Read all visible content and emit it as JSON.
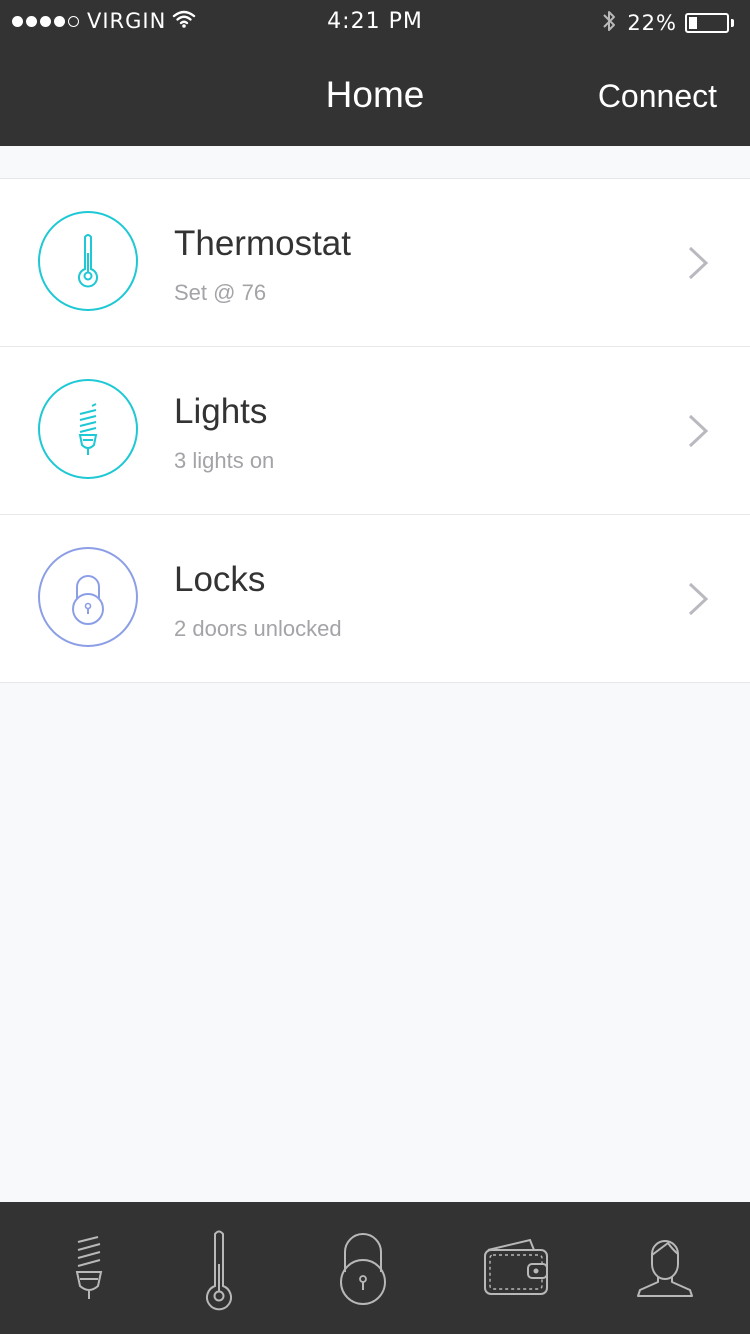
{
  "status_bar": {
    "carrier": "VIRGIN",
    "time": "4:21 PM",
    "battery": "22%",
    "battery_level": 0.22,
    "signal_bars": 4
  },
  "nav": {
    "title": "Home",
    "connect_label": "Connect"
  },
  "colors": {
    "accent_teal": "#1ec8d4",
    "accent_lavender": "#8c9fe6",
    "bar_background": "#333333",
    "page_background": "#f8f9fb"
  },
  "devices": [
    {
      "title": "Thermostat",
      "subtitle": "Set @ 76",
      "icon": "thermometer-icon"
    },
    {
      "title": "Lights",
      "subtitle": "3 lights on",
      "icon": "bulb-icon"
    },
    {
      "title": "Locks",
      "subtitle": "2 doors unlocked",
      "icon": "lock-icon"
    }
  ],
  "tabs": [
    {
      "icon": "bulb-icon"
    },
    {
      "icon": "thermometer-icon"
    },
    {
      "icon": "lock-icon"
    },
    {
      "icon": "wallet-icon"
    },
    {
      "icon": "user-icon"
    }
  ]
}
